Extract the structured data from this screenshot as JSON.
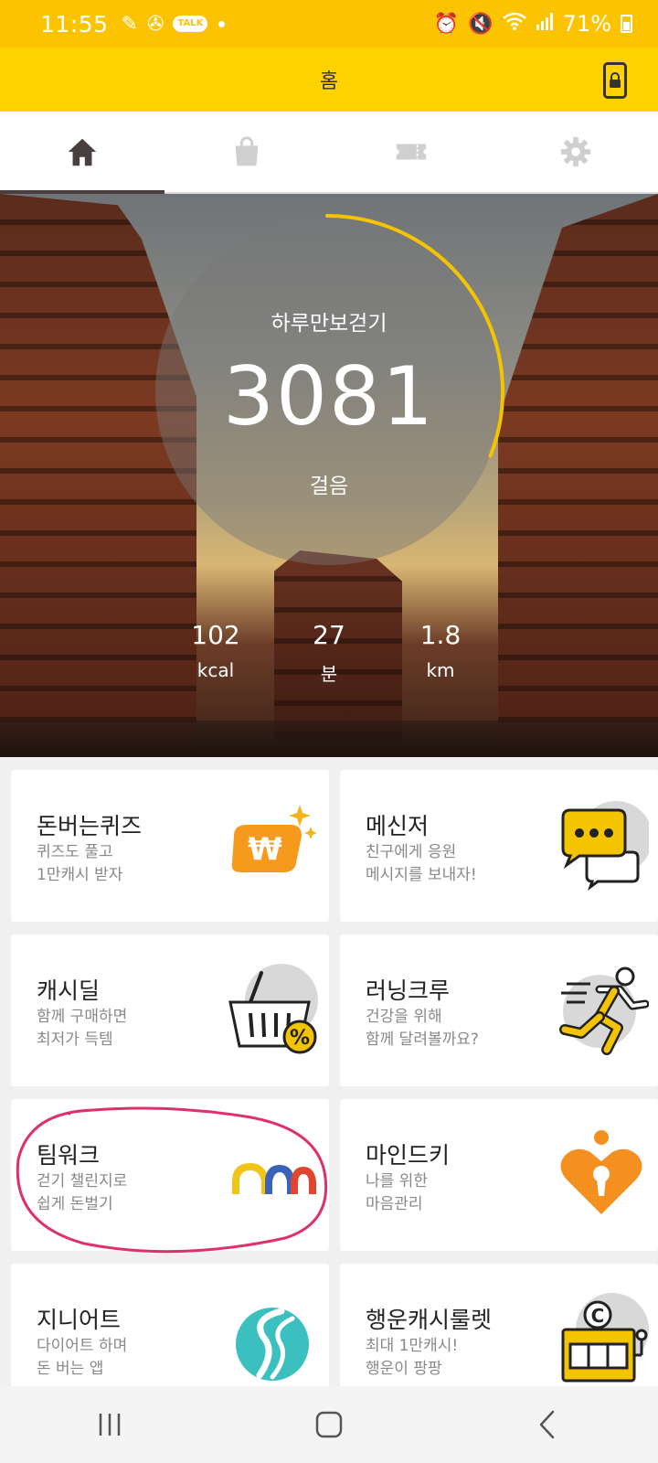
{
  "status_bar": {
    "time": "11:55",
    "kakao_label": "TALK",
    "battery": "71%"
  },
  "app_bar": {
    "title": "홈"
  },
  "tabs": [
    {
      "name": "home-tab",
      "icon": "home-icon",
      "active": true
    },
    {
      "name": "shop-tab",
      "icon": "shopping-bag-icon",
      "active": false
    },
    {
      "name": "coupon-tab",
      "icon": "ticket-icon",
      "active": false
    },
    {
      "name": "settings-tab",
      "icon": "gear-icon",
      "active": false
    }
  ],
  "hero": {
    "title": "하루만보걷기",
    "steps": "3081",
    "steps_unit": "걸음",
    "progress_fraction": 0.31,
    "stats": {
      "kcal_value": "102",
      "kcal_unit": "kcal",
      "minutes_value": "27",
      "minutes_unit": "분",
      "km_value": "1.8",
      "km_unit": "km"
    }
  },
  "cards": [
    {
      "title": "돈버는퀴즈",
      "desc": "퀴즈도 풀고\n1만캐시 받자",
      "icon": "won-coin-sparkle-icon"
    },
    {
      "title": "메신저",
      "desc": "친구에게 응원\n메시지를 보내자!",
      "icon": "chat-bubbles-icon"
    },
    {
      "title": "캐시딜",
      "desc": "함께 구매하면\n최저가 득템",
      "icon": "shopping-basket-percent-icon"
    },
    {
      "title": "러닝크루",
      "desc": "건강을 위해\n함께 달려볼까요?",
      "icon": "runner-icon"
    },
    {
      "title": "팀워크",
      "desc": "걷기 챌린지로\n쉽게 돈벌기",
      "icon": "teamwork-arches-icon"
    },
    {
      "title": "마인드키",
      "desc": "나를 위한\n마음관리",
      "icon": "heart-keyhole-icon"
    },
    {
      "title": "지니어트",
      "desc": "다이어트 하며\n돈 버는 앱",
      "icon": "diet-s-logo-icon"
    },
    {
      "title": "행운캐시룰렛",
      "desc": "최대 1만캐시!\n행운이 팡팡",
      "icon": "slot-machine-icon"
    }
  ],
  "colors": {
    "status_bar": "#fcc400",
    "app_bar": "#ffd200",
    "progress": "#f5c400",
    "annotation": "#e0306b"
  }
}
